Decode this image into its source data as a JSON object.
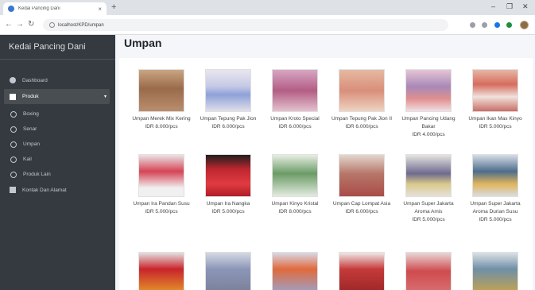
{
  "browser": {
    "tab_title": "Kedai Pancing Dani",
    "tab_close": "×",
    "new_tab": "+",
    "url": "localhost/KPD/umpan",
    "win_minimize": "–",
    "win_maximize": "❐",
    "win_close": "✕",
    "back": "←",
    "forward": "→",
    "reload": "↻"
  },
  "sidebar": {
    "brand": "Kedai Pancing Dani",
    "items": [
      {
        "label": "Dashboard",
        "icon": "dashboard-icon"
      },
      {
        "label": "Produk",
        "icon": "box-icon",
        "caret": "▾"
      },
      {
        "label": "Boxing",
        "icon": "circle-icon"
      },
      {
        "label": "Senar",
        "icon": "circle-icon"
      },
      {
        "label": "Umpan",
        "icon": "circle-icon"
      },
      {
        "label": "Kail",
        "icon": "circle-icon"
      },
      {
        "label": "Produk Lain",
        "icon": "circle-icon"
      },
      {
        "label": "Kontak Dan Alamat",
        "icon": "address-card-icon"
      }
    ]
  },
  "main": {
    "title": "Umpan",
    "products": [
      {
        "name": "Umpan Merek Mix Kering",
        "price": "IDR 8.000/pcs"
      },
      {
        "name": "Umpan Tepung Pak Jion",
        "price": "IDR 6.000/pcs"
      },
      {
        "name": "Umpan Kroto Special",
        "price": "IDR 6.000/pcs"
      },
      {
        "name": "Umpan Tepung Pak Jion II",
        "price": "IDR 6.000/pcs"
      },
      {
        "name": "Umpan Pancing Udang Bakar",
        "price": "IDR 4.000/pcs"
      },
      {
        "name": "Umpan Ikan Mas Kinyo",
        "price": "IDR 5.000/pcs"
      },
      {
        "name": "Umpan Ira Pandan Susu",
        "price": "IDR 5.000/pcs"
      },
      {
        "name": "Umpan Ira Nangka",
        "price": "IDR 5.000/pcs"
      },
      {
        "name": "Umpan Kinyo Kristal",
        "price": "IDR 8.000/pcs"
      },
      {
        "name": "Umpan Cap Lompat Asia",
        "price": "IDR 6.000/pcs"
      },
      {
        "name": "Umpan Super Jakarta Aroma Amis",
        "price": "IDR 5.000/pcs"
      },
      {
        "name": "Umpan Super Jakarta Aroma Durian Susu",
        "price": "IDR 5.000/pcs"
      },
      {
        "name": "",
        "price": ""
      },
      {
        "name": "",
        "price": ""
      },
      {
        "name": "",
        "price": ""
      },
      {
        "name": "",
        "price": ""
      },
      {
        "name": "",
        "price": ""
      },
      {
        "name": "",
        "price": ""
      }
    ]
  },
  "colors": {
    "sidebar_bg": "#343a40",
    "content_bg": "#f4f6f9",
    "active_item_bg": "#494e53"
  }
}
